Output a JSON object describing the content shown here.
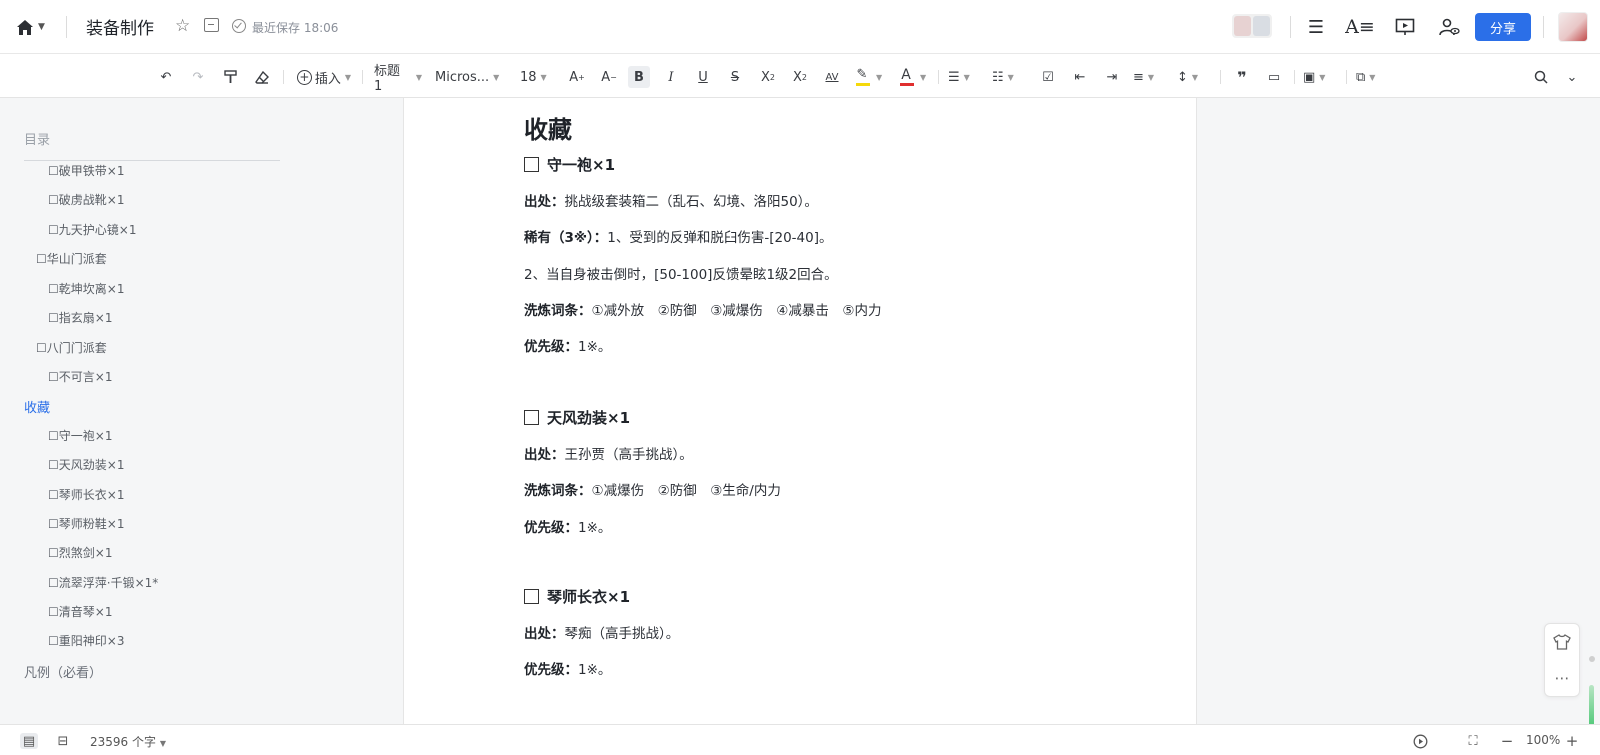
{
  "header": {
    "doc_title": "装备制作",
    "save_status": "最近保存 18:06",
    "share_label": "分享"
  },
  "toolbar": {
    "insert_label": "插入",
    "heading_style": "标题 1",
    "font_name": "Micros...",
    "font_size": "18"
  },
  "sidebar": {
    "title": "目录",
    "items": [
      {
        "label": "☐破甲铁带×1",
        "level": 3
      },
      {
        "label": "☐破虏战靴×1",
        "level": 3
      },
      {
        "label": "☐九天护心镜×1",
        "level": 3
      },
      {
        "label": "☐华山门派套",
        "level": 2
      },
      {
        "label": "☐乾坤坎离×1",
        "level": 3
      },
      {
        "label": "☐指玄扇×1",
        "level": 3
      },
      {
        "label": "☐八门门派套",
        "level": 2
      },
      {
        "label": "☐不可言×1",
        "level": 3
      },
      {
        "label": "收藏",
        "level": 1,
        "active": true
      },
      {
        "label": "☐守一袍×1",
        "level": 3
      },
      {
        "label": "☐天风劲装×1",
        "level": 3
      },
      {
        "label": "☐琴师长衣×1",
        "level": 3
      },
      {
        "label": "☐琴师粉鞋×1",
        "level": 3
      },
      {
        "label": "☐烈煞剑×1",
        "level": 3
      },
      {
        "label": "☐流翠浮萍·千锻×1*",
        "level": 3
      },
      {
        "label": "☐清音琴×1",
        "level": 3
      },
      {
        "label": "☐重阳神印×3",
        "level": 3
      },
      {
        "label": "凡例（必看）",
        "level": 1
      }
    ]
  },
  "document": {
    "heading": "收藏",
    "sections": [
      {
        "title": "守一袍×1",
        "lines": [
          {
            "label": "出处：",
            "text": "挑战级套装箱二（乱石、幻境、洛阳50）。"
          },
          {
            "label": "稀有（3※）：",
            "text": "1、受到的反弹和脱臼伤害-[20-40]。"
          },
          {
            "label": "",
            "text": "2、当自身被击倒时，[50-100]反馈晕眩1级2回合。"
          },
          {
            "label": "洗炼词条：",
            "text": "①减外放　②防御　③减爆伤　④减暴击　⑤内力"
          },
          {
            "label": "优先级：",
            "text": "1※。"
          }
        ]
      },
      {
        "title": "天风劲装×1",
        "lines": [
          {
            "label": "出处：",
            "text": "王孙贾（高手挑战）。"
          },
          {
            "label": "洗炼词条：",
            "text": "①减爆伤　②防御　③生命/内力"
          },
          {
            "label": "优先级：",
            "text": "1※。"
          }
        ]
      },
      {
        "title": "琴师长衣×1",
        "lines": [
          {
            "label": "出处：",
            "text": "琴痴（高手挑战）。"
          },
          {
            "label": "优先级：",
            "text": "1※。"
          }
        ]
      }
    ]
  },
  "statusbar": {
    "word_count": "23596 个字",
    "zoom": "100%"
  },
  "colors": {
    "accent": "#2b6fe8",
    "highlight": "#f5d90a",
    "font_color": "#e02e2e"
  }
}
